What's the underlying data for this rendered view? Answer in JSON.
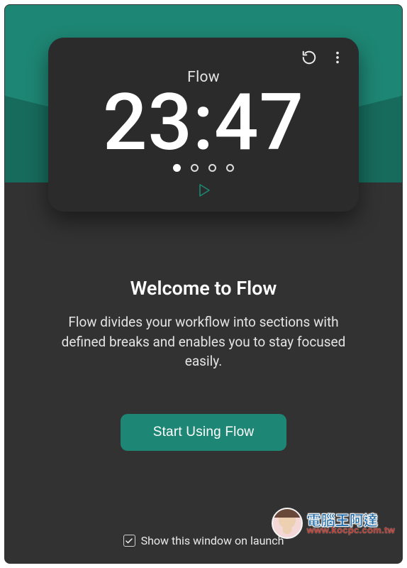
{
  "timer": {
    "title": "Flow",
    "time": "23:47",
    "dots_total": 4,
    "dots_filled": 1
  },
  "welcome": {
    "heading": "Welcome to Flow",
    "description": "Flow divides your workflow into sections with defined breaks and enables you to stay focused easily.",
    "cta_label": "Start Using Flow"
  },
  "footer": {
    "show_on_launch_label": "Show this window on launch",
    "show_on_launch_checked": true
  },
  "watermark": {
    "title": "電腦王阿達",
    "url": "www.kocpc.com.tw"
  },
  "colors": {
    "accent": "#1e8674",
    "card": "#2b2b2b",
    "panel": "#323232"
  }
}
